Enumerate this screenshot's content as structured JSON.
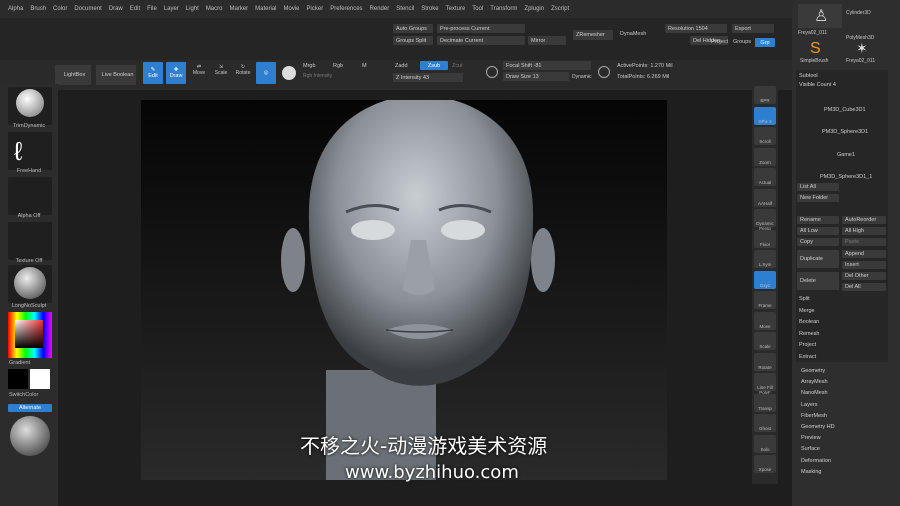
{
  "menu": [
    "Alpha",
    "Brush",
    "Color",
    "Document",
    "Draw",
    "Edit",
    "File",
    "Layer",
    "Light",
    "Macro",
    "Marker",
    "Material",
    "Movie",
    "Picker",
    "Preferences",
    "Render",
    "Stencil",
    "Stroke",
    "Texture",
    "Tool",
    "Transform",
    "Zplugin",
    "Zscript"
  ],
  "top": {
    "auto_groups": "Auto Groups",
    "preprocess": "Pre-process Current",
    "groups_split": "Groups Split",
    "decimate": "Decimate Current",
    "mirror": "Mirror",
    "zremesher": "ZRemesher",
    "dynamesh": "DynaMesh",
    "resolution": "Resolution 1504",
    "export": "Export",
    "del_hidden": "Del Hidden",
    "project": "Project",
    "groups": "Groups",
    "grp": "Grp"
  },
  "shelf": {
    "lightbox": "LightBox",
    "live_boolean": "Live Boolean",
    "edit": "Edit",
    "draw": "Draw",
    "move": "Move",
    "scale": "Scale",
    "rotate": "Rotate",
    "mrgb": "Mrgb",
    "rgb": "Rgb",
    "m": "M",
    "zadd": "Zadd",
    "zsub": "Zsub",
    "zcut": "Zcut",
    "rgb_intensity": "Rgb Intensity",
    "z_intensity": "Z Intensity 43",
    "focal_shift": "Focal Shift -81",
    "draw_size": "Draw Size 13",
    "dynamic": "Dynamic",
    "active_points": "ActivePoints: 1.270 Mil",
    "total_points": "TotalPoints: 6.269 Mil"
  },
  "left": {
    "brush": "TrimDynamic",
    "stroke": "FreeHand",
    "alpha": "Alpha Off",
    "texture": "Texture Off",
    "material": "LongNoSculpt",
    "gradient": "Gradient",
    "switch_color": "SwitchColor",
    "alternate": "Alternate"
  },
  "right_strip": [
    "BPR",
    "SPix 3",
    "Scroll",
    "Zoom",
    "Actual",
    "AAHalf",
    "Dynamic Persp",
    "Floor",
    "L.Sym",
    "Gxyz",
    "Frame",
    "Move",
    "Scale",
    "Rotate",
    "Line Fill PolyF",
    "Transp",
    "Ghost",
    "Solo",
    "Xpose"
  ],
  "tool_panel": {
    "thumbs": [
      "Freya02_011",
      "Cylinder3D",
      "SimpleBrush",
      "PolyMesh3D",
      "Freya02_011"
    ],
    "subtool_title": "Subtool",
    "visible_count": "Visible Count 4",
    "subtools": [
      "PM3D_Cube3D1",
      "PM3D_Sphere3D1",
      "Game1",
      "PM3D_Sphere3D1_1"
    ],
    "list_all": "List All",
    "new_folder": "New Folder",
    "rename": "Rename",
    "autoreorder": "AutoReorder",
    "all_low": "All Low",
    "all_high": "All High",
    "copy": "Copy",
    "paste": "Paste",
    "duplicate": "Duplicate",
    "append": "Append",
    "insert": "Insert",
    "delete": "Delete",
    "del_other": "Del Other",
    "del_all": "Del All",
    "actions": [
      "Split",
      "Merge",
      "Boolean",
      "Remesh",
      "Project",
      "Extract"
    ],
    "menus": [
      "Geometry",
      "ArrayMesh",
      "NanoMesh",
      "Layers",
      "FiberMesh",
      "Geometry HD",
      "Preview",
      "Surface",
      "Deformation",
      "Masking"
    ]
  },
  "watermark": {
    "line1": "不移之火-动漫游戏美术资源",
    "line2": "www.byzhihuo.com"
  }
}
